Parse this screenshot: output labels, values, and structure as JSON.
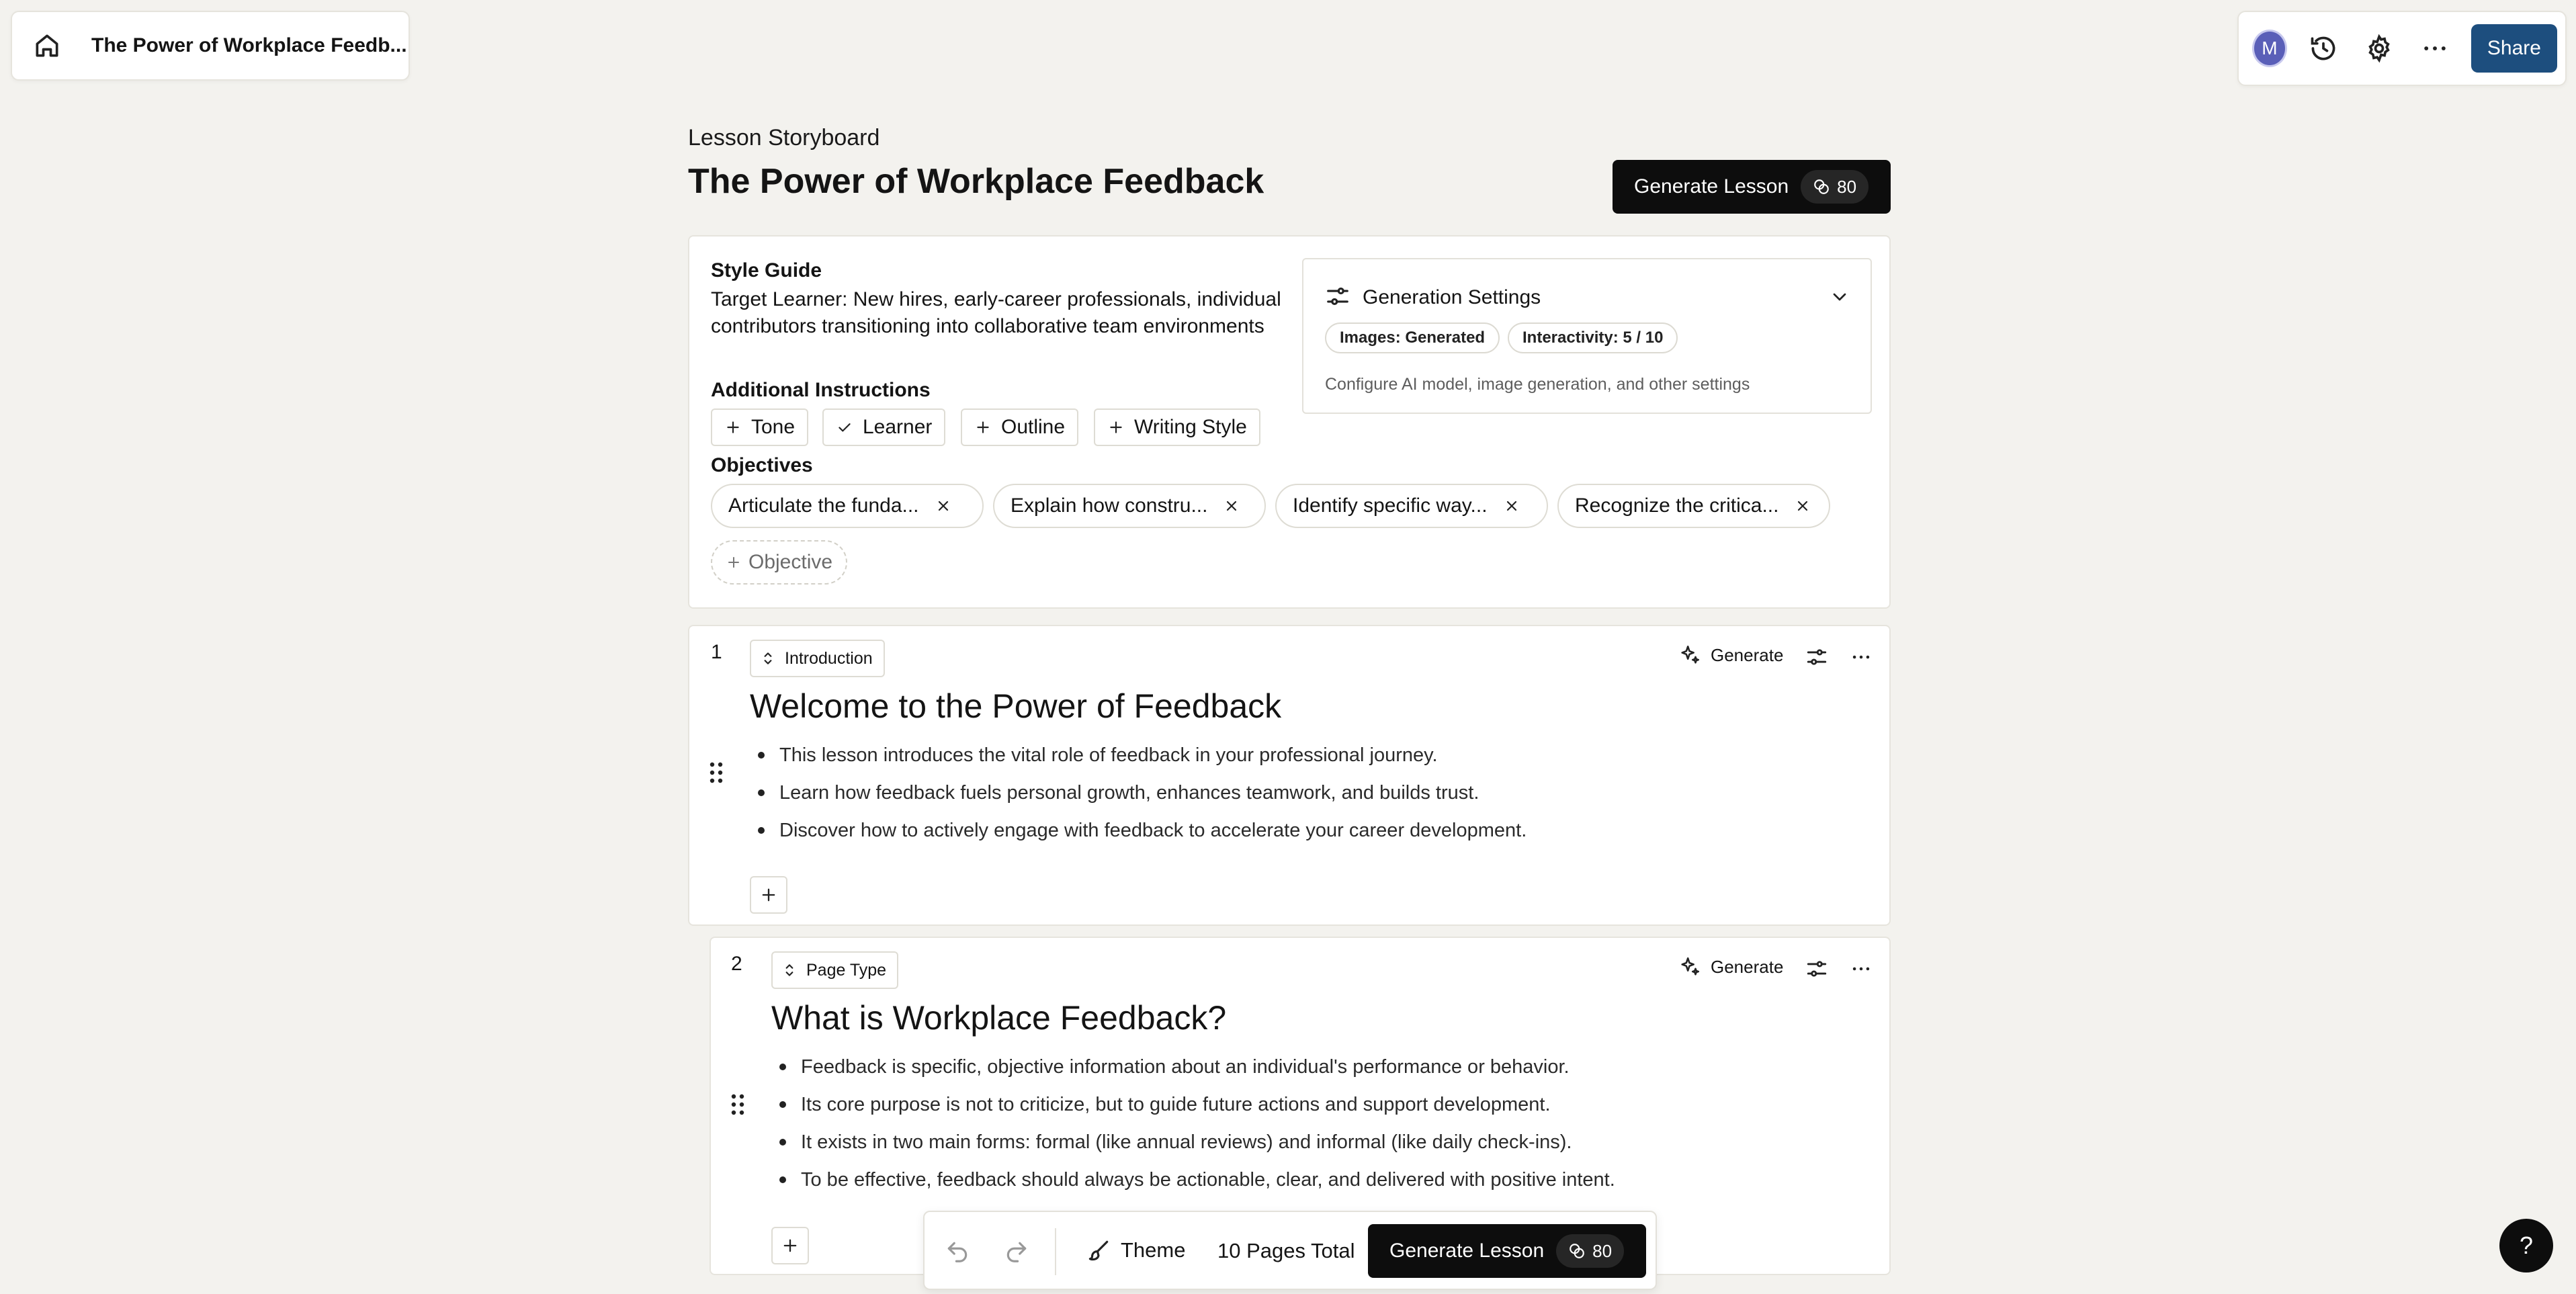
{
  "breadcrumb": {
    "title": "The Power of Workplace Feedb..."
  },
  "topbar": {
    "avatar_initial": "M",
    "share_label": "Share"
  },
  "header": {
    "kicker": "Lesson Storyboard",
    "title": "The Power of Workplace Feedback",
    "generate_label": "Generate Lesson",
    "credits": "80"
  },
  "style_guide": {
    "label": "Style Guide",
    "target_learner": "Target Learner: New hires, early-career professionals, individual contributors transitioning into collaborative team environments",
    "additional_label": "Additional Instructions",
    "instructions": [
      {
        "label": "Tone",
        "icon": "plus-icon"
      },
      {
        "label": "Learner",
        "icon": "check-icon"
      },
      {
        "label": "Outline",
        "icon": "plus-icon"
      },
      {
        "label": "Writing Style",
        "icon": "plus-icon"
      }
    ],
    "objectives_label": "Objectives",
    "objectives": [
      "Articulate the funda...",
      "Explain how constru...",
      "Identify specific way...",
      "Recognize the critica..."
    ],
    "add_objective": "Objective"
  },
  "generation_settings": {
    "title": "Generation Settings",
    "pills": [
      "Images: Generated",
      "Interactivity: 5 / 10"
    ],
    "description": "Configure AI model, image generation, and other settings"
  },
  "pages": [
    {
      "number": "1",
      "type": "Introduction",
      "title": "Welcome to the Power of Feedback",
      "generate_label": "Generate",
      "bullets": [
        "This lesson introduces the vital role of feedback in your professional journey.",
        "Learn how feedback fuels personal growth, enhances teamwork, and builds trust.",
        "Discover how to actively engage with feedback to accelerate your career development."
      ]
    },
    {
      "number": "2",
      "type": "Page Type",
      "title": "What is Workplace Feedback?",
      "generate_label": "Generate",
      "bullets": [
        "Feedback is specific, objective information about an individual's performance or behavior.",
        "Its core purpose is not to criticize, but to guide future actions and support development.",
        "It exists in two main forms: formal (like annual reviews) and informal (like daily check-ins).",
        "To be effective, feedback should always be actionable, clear, and delivered with positive intent."
      ]
    }
  ],
  "bottombar": {
    "theme_label": "Theme",
    "pages_total": "10 Pages Total",
    "generate_label": "Generate Lesson",
    "credits": "80"
  },
  "help_label": "?"
}
